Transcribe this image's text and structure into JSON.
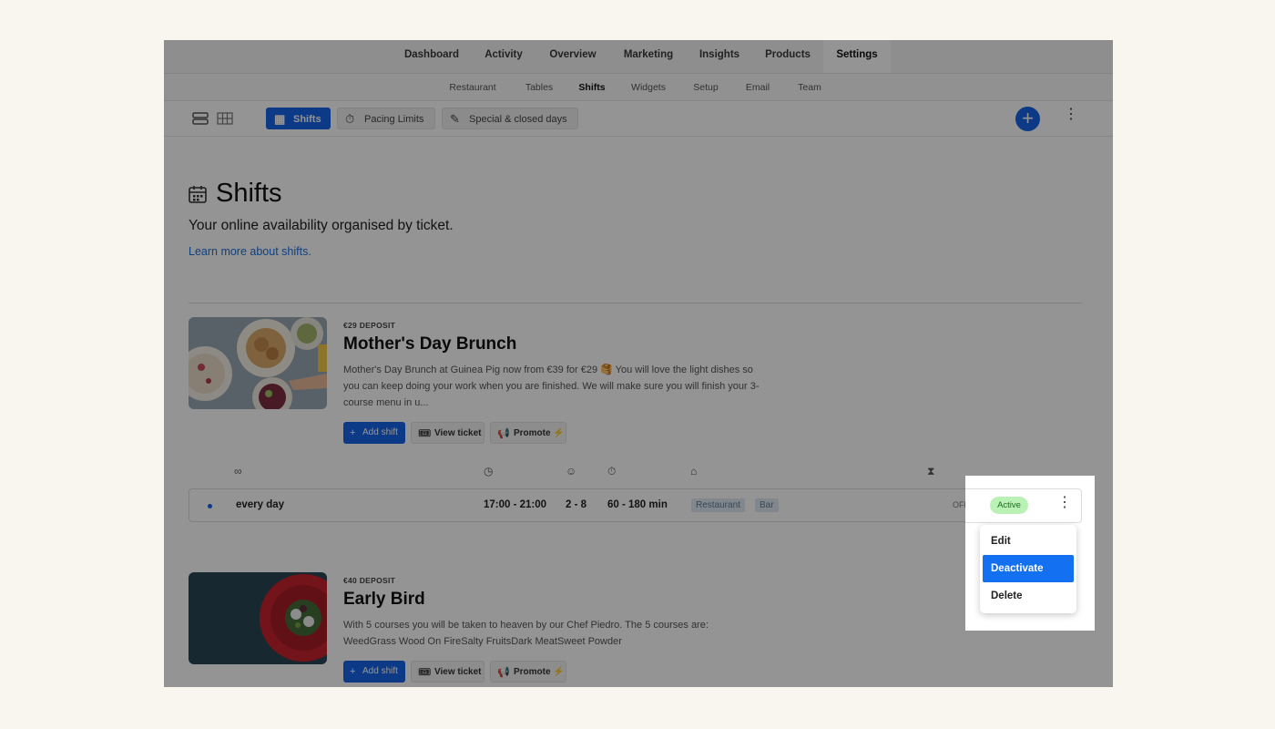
{
  "top_nav": {
    "items": [
      "Dashboard",
      "Activity",
      "Overview",
      "Marketing",
      "Insights",
      "Products",
      "Settings"
    ],
    "active": "Settings"
  },
  "sub_nav": {
    "items": [
      "Restaurant",
      "Tables",
      "Shifts",
      "Widgets",
      "Setup",
      "Email",
      "Team"
    ],
    "active": "Shifts"
  },
  "toolbar": {
    "tabs": [
      {
        "label": "Shifts",
        "icon": "calendar-icon",
        "active": true
      },
      {
        "label": "Pacing Limits",
        "icon": "stopwatch-icon",
        "active": false
      },
      {
        "label": "Special & closed days",
        "icon": "calendar-edit-icon",
        "active": false
      }
    ],
    "add_label": "+"
  },
  "page": {
    "title": "Shifts",
    "subtitle": "Your online availability organised by ticket.",
    "link": "Learn more about shifts."
  },
  "tickets": [
    {
      "deposit": "€29 DEPOSIT",
      "title": "Mother's Day Brunch",
      "description": "Mother's Day Brunch at Guinea Pig now from €39 for €29 🥞 You will love the light dishes so you can keep doing your work when you are finished. We will make sure you will finish your 3-course menu in u...",
      "add_shift": "Add shift",
      "view_ticket": "View ticket",
      "promote": "Promote",
      "promote_icon": "⚡"
    },
    {
      "deposit": "€40 DEPOSIT",
      "title": "Early Bird",
      "description": "With 5 courses you will be taken to heaven by our Chef Piedro. The 5 courses are: WeedGrass Wood On FireSalty FruitsDark MeatSweet Powder",
      "add_shift": "Add shift",
      "view_ticket": "View ticket",
      "promote": "Promote",
      "promote_icon": "⚡"
    }
  ],
  "shift": {
    "recurrence": "every day",
    "time": "17:00 - 21:00",
    "guests": "2 - 8",
    "duration": "60 - 180 min",
    "areas": [
      "Restaurant",
      "Bar"
    ],
    "waitlist": "OFF",
    "status": "Active"
  },
  "context_menu": {
    "items": [
      "Edit",
      "Deactivate",
      "Delete"
    ],
    "highlighted": "Deactivate"
  },
  "colors": {
    "accent": "#1565e8",
    "active_badge": "#b9f2b4",
    "page_bg": "#f8f6ef"
  }
}
